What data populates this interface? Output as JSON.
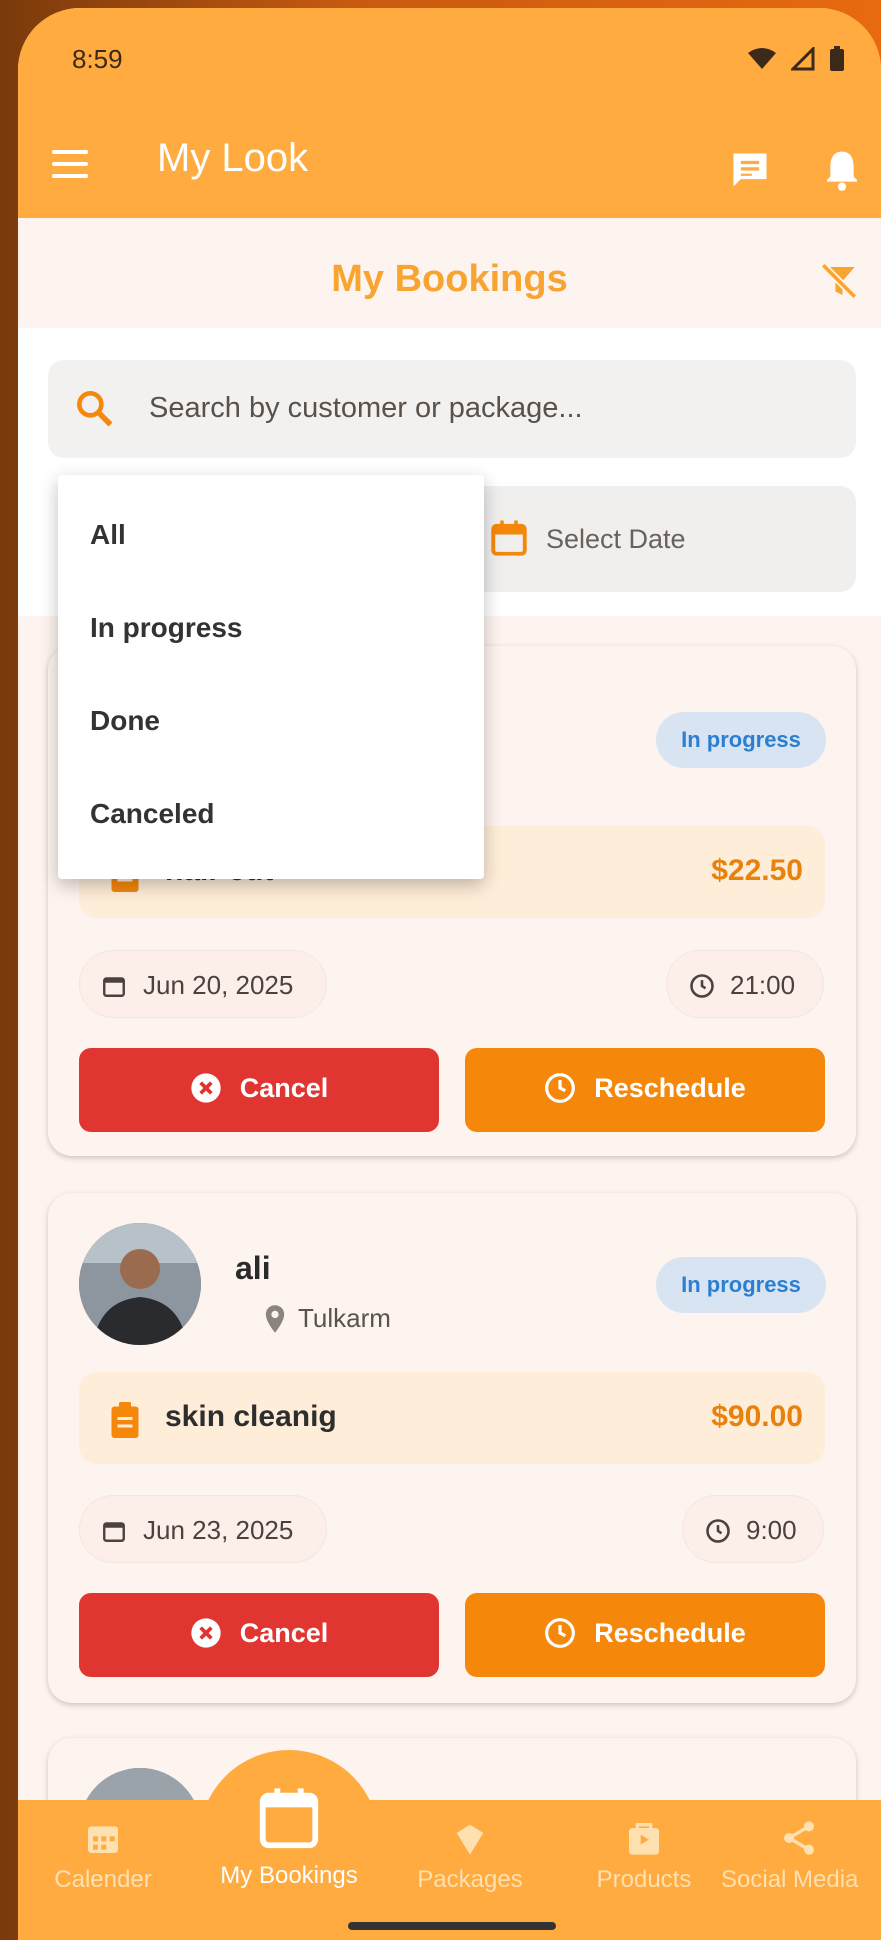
{
  "status_bar": {
    "time": "8:59"
  },
  "app_bar": {
    "title": "My Look"
  },
  "header": {
    "title": "My Bookings"
  },
  "search": {
    "placeholder": "Search by customer or package..."
  },
  "date_filter": {
    "label": "Select Date"
  },
  "status_dropdown": {
    "options": [
      "All",
      "In progress",
      "Done",
      "Canceled"
    ]
  },
  "bookings": [
    {
      "customer": "",
      "location": "",
      "status": "In progress",
      "service": "hair cut",
      "price": "$22.50",
      "date": "Jun 20, 2025",
      "time": "21:00",
      "cancel_label": "Cancel",
      "reschedule_label": "Reschedule"
    },
    {
      "customer": "ali",
      "location": "Tulkarm",
      "status": "In progress",
      "service": "skin cleanig",
      "price": "$90.00",
      "date": "Jun 23, 2025",
      "time": "9:00",
      "cancel_label": "Cancel",
      "reschedule_label": "Reschedule"
    }
  ],
  "bottom_nav": {
    "items": [
      {
        "label": "Calender",
        "icon": "calendar-grid-icon"
      },
      {
        "label": "My Bookings",
        "icon": "calendar-icon"
      },
      {
        "label": "Packages",
        "icon": "package-icon"
      },
      {
        "label": "Products",
        "icon": "shopping-bag-icon"
      },
      {
        "label": "Social Media",
        "icon": "share-icon"
      }
    ],
    "active": "My Bookings"
  },
  "colors": {
    "primary": "#ffab3f",
    "accent": "#f5870a",
    "danger": "#e03530",
    "badge_bg": "#d9e4f2",
    "badge_text": "#2b7fd0"
  }
}
